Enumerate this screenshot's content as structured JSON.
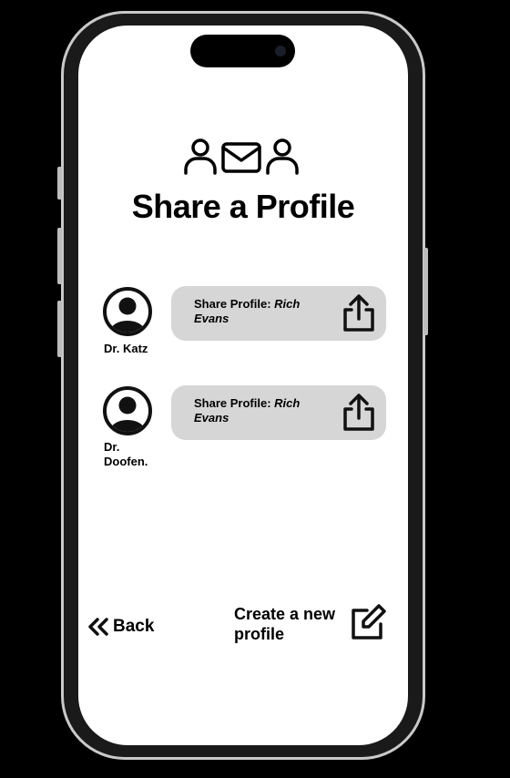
{
  "title": "Share a Profile",
  "profiles": [
    {
      "name": "Dr. Katz",
      "share_prefix": "Share Profile: ",
      "share_name": "Rich Evans"
    },
    {
      "name": "Dr. Doofen.",
      "share_prefix": "Share Profile: ",
      "share_name": "Rich Evans"
    }
  ],
  "nav": {
    "back_label": "Back",
    "create_label": "Create a new profile"
  },
  "colors": {
    "pill_background": "#d6d6d6",
    "text": "#000000",
    "screen": "#ffffff"
  },
  "icons": {
    "header": "people-mail-icon",
    "avatar": "user-circle-icon",
    "share": "share-icon",
    "back": "double-chevron-left-icon",
    "create": "edit-icon"
  }
}
